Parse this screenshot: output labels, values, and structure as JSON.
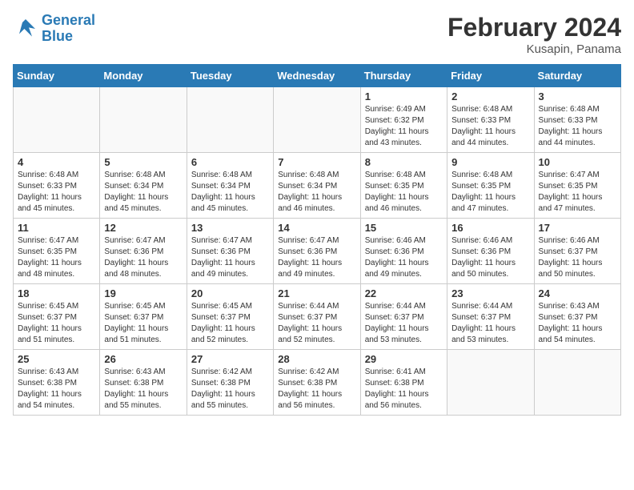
{
  "header": {
    "logo_line1": "General",
    "logo_line2": "Blue",
    "month_title": "February 2024",
    "location": "Kusapin, Panama"
  },
  "weekdays": [
    "Sunday",
    "Monday",
    "Tuesday",
    "Wednesday",
    "Thursday",
    "Friday",
    "Saturday"
  ],
  "weeks": [
    [
      {
        "day": "",
        "sunrise": "",
        "sunset": "",
        "daylight": ""
      },
      {
        "day": "",
        "sunrise": "",
        "sunset": "",
        "daylight": ""
      },
      {
        "day": "",
        "sunrise": "",
        "sunset": "",
        "daylight": ""
      },
      {
        "day": "",
        "sunrise": "",
        "sunset": "",
        "daylight": ""
      },
      {
        "day": "1",
        "sunrise": "Sunrise: 6:49 AM",
        "sunset": "Sunset: 6:32 PM",
        "daylight": "Daylight: 11 hours and 43 minutes."
      },
      {
        "day": "2",
        "sunrise": "Sunrise: 6:48 AM",
        "sunset": "Sunset: 6:33 PM",
        "daylight": "Daylight: 11 hours and 44 minutes."
      },
      {
        "day": "3",
        "sunrise": "Sunrise: 6:48 AM",
        "sunset": "Sunset: 6:33 PM",
        "daylight": "Daylight: 11 hours and 44 minutes."
      }
    ],
    [
      {
        "day": "4",
        "sunrise": "Sunrise: 6:48 AM",
        "sunset": "Sunset: 6:33 PM",
        "daylight": "Daylight: 11 hours and 45 minutes."
      },
      {
        "day": "5",
        "sunrise": "Sunrise: 6:48 AM",
        "sunset": "Sunset: 6:34 PM",
        "daylight": "Daylight: 11 hours and 45 minutes."
      },
      {
        "day": "6",
        "sunrise": "Sunrise: 6:48 AM",
        "sunset": "Sunset: 6:34 PM",
        "daylight": "Daylight: 11 hours and 45 minutes."
      },
      {
        "day": "7",
        "sunrise": "Sunrise: 6:48 AM",
        "sunset": "Sunset: 6:34 PM",
        "daylight": "Daylight: 11 hours and 46 minutes."
      },
      {
        "day": "8",
        "sunrise": "Sunrise: 6:48 AM",
        "sunset": "Sunset: 6:35 PM",
        "daylight": "Daylight: 11 hours and 46 minutes."
      },
      {
        "day": "9",
        "sunrise": "Sunrise: 6:48 AM",
        "sunset": "Sunset: 6:35 PM",
        "daylight": "Daylight: 11 hours and 47 minutes."
      },
      {
        "day": "10",
        "sunrise": "Sunrise: 6:47 AM",
        "sunset": "Sunset: 6:35 PM",
        "daylight": "Daylight: 11 hours and 47 minutes."
      }
    ],
    [
      {
        "day": "11",
        "sunrise": "Sunrise: 6:47 AM",
        "sunset": "Sunset: 6:35 PM",
        "daylight": "Daylight: 11 hours and 48 minutes."
      },
      {
        "day": "12",
        "sunrise": "Sunrise: 6:47 AM",
        "sunset": "Sunset: 6:36 PM",
        "daylight": "Daylight: 11 hours and 48 minutes."
      },
      {
        "day": "13",
        "sunrise": "Sunrise: 6:47 AM",
        "sunset": "Sunset: 6:36 PM",
        "daylight": "Daylight: 11 hours and 49 minutes."
      },
      {
        "day": "14",
        "sunrise": "Sunrise: 6:47 AM",
        "sunset": "Sunset: 6:36 PM",
        "daylight": "Daylight: 11 hours and 49 minutes."
      },
      {
        "day": "15",
        "sunrise": "Sunrise: 6:46 AM",
        "sunset": "Sunset: 6:36 PM",
        "daylight": "Daylight: 11 hours and 49 minutes."
      },
      {
        "day": "16",
        "sunrise": "Sunrise: 6:46 AM",
        "sunset": "Sunset: 6:36 PM",
        "daylight": "Daylight: 11 hours and 50 minutes."
      },
      {
        "day": "17",
        "sunrise": "Sunrise: 6:46 AM",
        "sunset": "Sunset: 6:37 PM",
        "daylight": "Daylight: 11 hours and 50 minutes."
      }
    ],
    [
      {
        "day": "18",
        "sunrise": "Sunrise: 6:45 AM",
        "sunset": "Sunset: 6:37 PM",
        "daylight": "Daylight: 11 hours and 51 minutes."
      },
      {
        "day": "19",
        "sunrise": "Sunrise: 6:45 AM",
        "sunset": "Sunset: 6:37 PM",
        "daylight": "Daylight: 11 hours and 51 minutes."
      },
      {
        "day": "20",
        "sunrise": "Sunrise: 6:45 AM",
        "sunset": "Sunset: 6:37 PM",
        "daylight": "Daylight: 11 hours and 52 minutes."
      },
      {
        "day": "21",
        "sunrise": "Sunrise: 6:44 AM",
        "sunset": "Sunset: 6:37 PM",
        "daylight": "Daylight: 11 hours and 52 minutes."
      },
      {
        "day": "22",
        "sunrise": "Sunrise: 6:44 AM",
        "sunset": "Sunset: 6:37 PM",
        "daylight": "Daylight: 11 hours and 53 minutes."
      },
      {
        "day": "23",
        "sunrise": "Sunrise: 6:44 AM",
        "sunset": "Sunset: 6:37 PM",
        "daylight": "Daylight: 11 hours and 53 minutes."
      },
      {
        "day": "24",
        "sunrise": "Sunrise: 6:43 AM",
        "sunset": "Sunset: 6:37 PM",
        "daylight": "Daylight: 11 hours and 54 minutes."
      }
    ],
    [
      {
        "day": "25",
        "sunrise": "Sunrise: 6:43 AM",
        "sunset": "Sunset: 6:38 PM",
        "daylight": "Daylight: 11 hours and 54 minutes."
      },
      {
        "day": "26",
        "sunrise": "Sunrise: 6:43 AM",
        "sunset": "Sunset: 6:38 PM",
        "daylight": "Daylight: 11 hours and 55 minutes."
      },
      {
        "day": "27",
        "sunrise": "Sunrise: 6:42 AM",
        "sunset": "Sunset: 6:38 PM",
        "daylight": "Daylight: 11 hours and 55 minutes."
      },
      {
        "day": "28",
        "sunrise": "Sunrise: 6:42 AM",
        "sunset": "Sunset: 6:38 PM",
        "daylight": "Daylight: 11 hours and 56 minutes."
      },
      {
        "day": "29",
        "sunrise": "Sunrise: 6:41 AM",
        "sunset": "Sunset: 6:38 PM",
        "daylight": "Daylight: 11 hours and 56 minutes."
      },
      {
        "day": "",
        "sunrise": "",
        "sunset": "",
        "daylight": ""
      },
      {
        "day": "",
        "sunrise": "",
        "sunset": "",
        "daylight": ""
      }
    ]
  ]
}
